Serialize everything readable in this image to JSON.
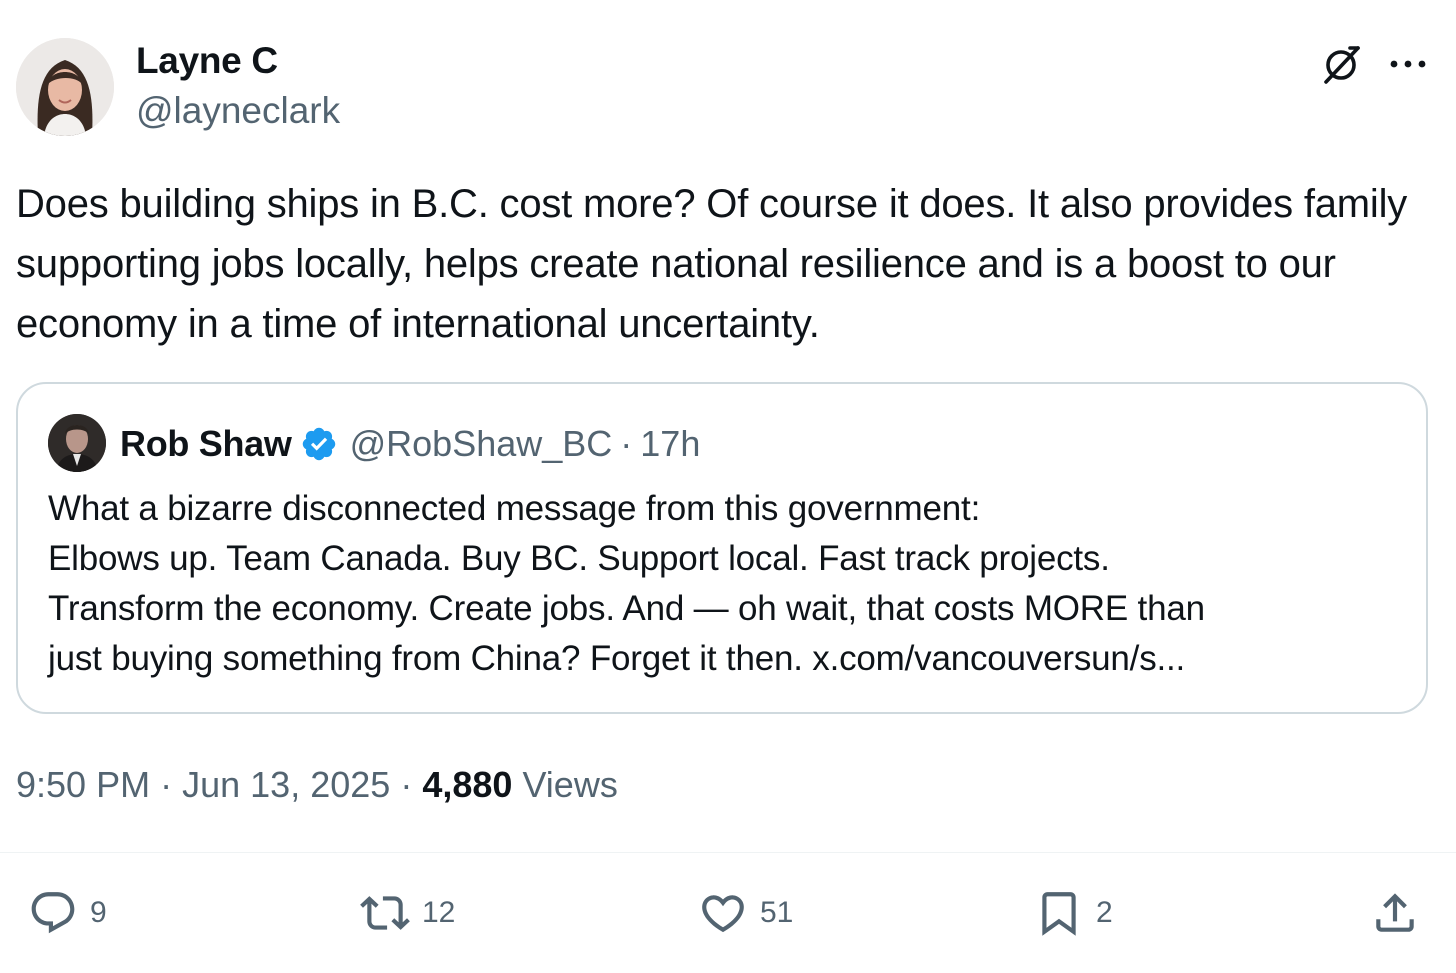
{
  "author": {
    "name": "Layne C",
    "handle": "@layneclark"
  },
  "header_icons": [
    "grok-icon",
    "more-options-icon"
  ],
  "tweet": {
    "text": "Does building ships in B.C. cost more? Of course it does. It also provides family supporting jobs locally, helps create national resilience and is a boost to our economy in a time of international uncertainty."
  },
  "quoted_tweet": {
    "name": "Rob Shaw",
    "verified": true,
    "handle": "@RobShaw_BC",
    "separator": "·",
    "time": "17h",
    "lines": [
      "What a bizarre disconnected message from this government:",
      "Elbows up. Team Canada. Buy BC. Support local. Fast track projects.",
      "Transform the economy. Create jobs. And — oh wait, that costs MORE than",
      "just buying something from China? Forget it then. x.com/vancouversun/s..."
    ]
  },
  "meta": {
    "time": "9:50 PM",
    "separator": "·",
    "date": "Jun 13, 2025",
    "views_count": "4,880",
    "views_label": "Views"
  },
  "actions": {
    "replies": "9",
    "reposts": "12",
    "likes": "51",
    "bookmarks": "2"
  },
  "colors": {
    "text": "#0f1419",
    "secondary": "#536471",
    "border": "#cfd9de",
    "verified": "#1d9bf0"
  }
}
